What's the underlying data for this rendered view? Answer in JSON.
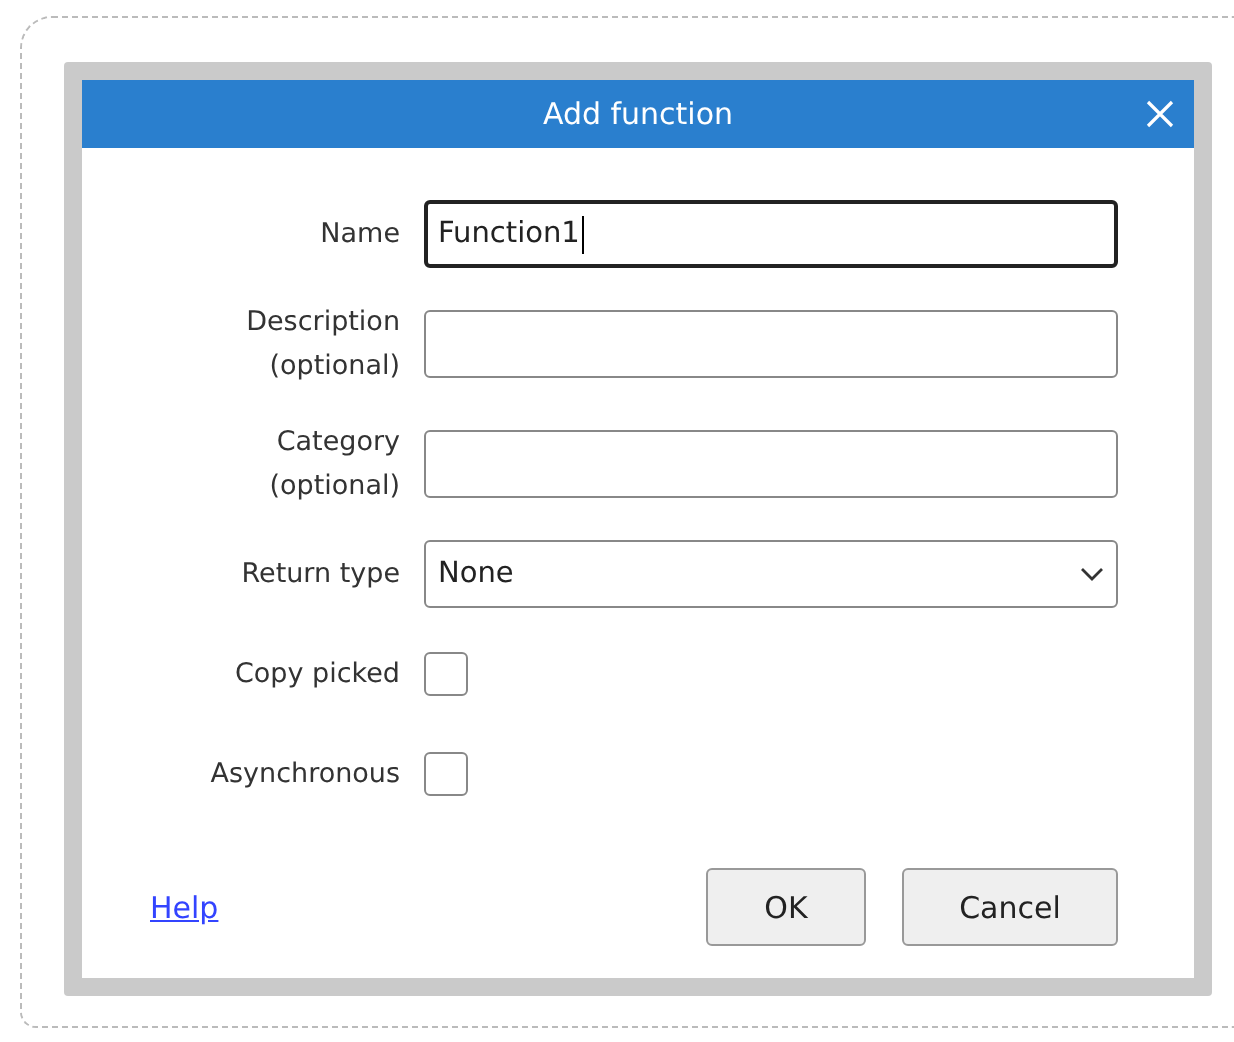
{
  "window": {
    "title": "Add function"
  },
  "fields": [
    {
      "kind": "text",
      "label": [
        "Name"
      ],
      "value": "Function1",
      "focused": true
    },
    {
      "kind": "text",
      "label": [
        "Description",
        "(optional)"
      ],
      "focused": false
    },
    {
      "kind": "text",
      "label": [
        "Category",
        "(optional)"
      ],
      "focused": false
    },
    {
      "kind": "select",
      "label": [
        "Return type"
      ],
      "value": "None"
    },
    {
      "kind": "checkbox",
      "label": [
        "Copy picked"
      ],
      "checked": false
    },
    {
      "kind": "checkbox",
      "label": [
        "Asynchronous"
      ],
      "checked": false
    }
  ],
  "help_link": "Help",
  "buttons": [
    "OK",
    "Cancel"
  ]
}
